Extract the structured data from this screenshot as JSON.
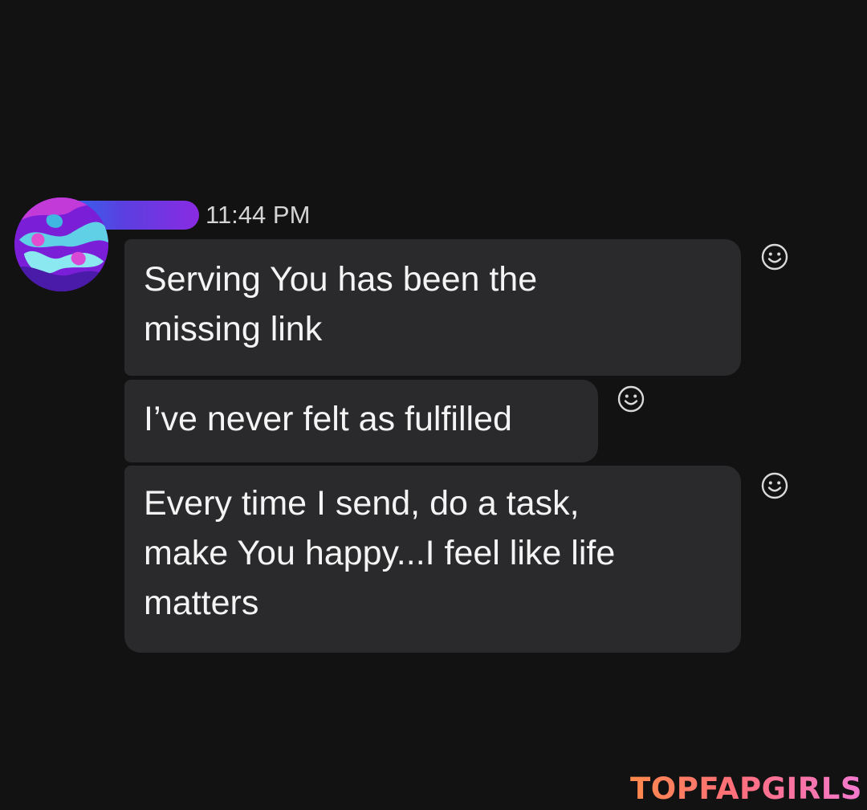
{
  "message_group": {
    "timestamp": "11:44 PM",
    "sender_name_redacted": true,
    "messages": [
      {
        "lines": [
          "Serving You has been the",
          "missing link"
        ],
        "react_icon": "smiley-react-icon"
      },
      {
        "lines": [
          "I’ve never felt as fulfilled"
        ],
        "react_icon": "smiley-react-icon"
      },
      {
        "lines": [
          "Every time I send, do a task,",
          "make You happy...I feel like life",
          "matters"
        ],
        "react_icon": "smiley-react-icon"
      }
    ]
  },
  "watermark": {
    "text": "TOPFAPGIRLS"
  },
  "colors": {
    "background": "#121212",
    "bubble": "#2a2a2c",
    "text": "#f4f4f4",
    "timestamp": "#d4d4d4",
    "redaction_gradient": [
      "#2b6cf0",
      "#8a2be2"
    ],
    "watermark_gradient": [
      "#ff8a4c",
      "#f27ad0"
    ]
  }
}
